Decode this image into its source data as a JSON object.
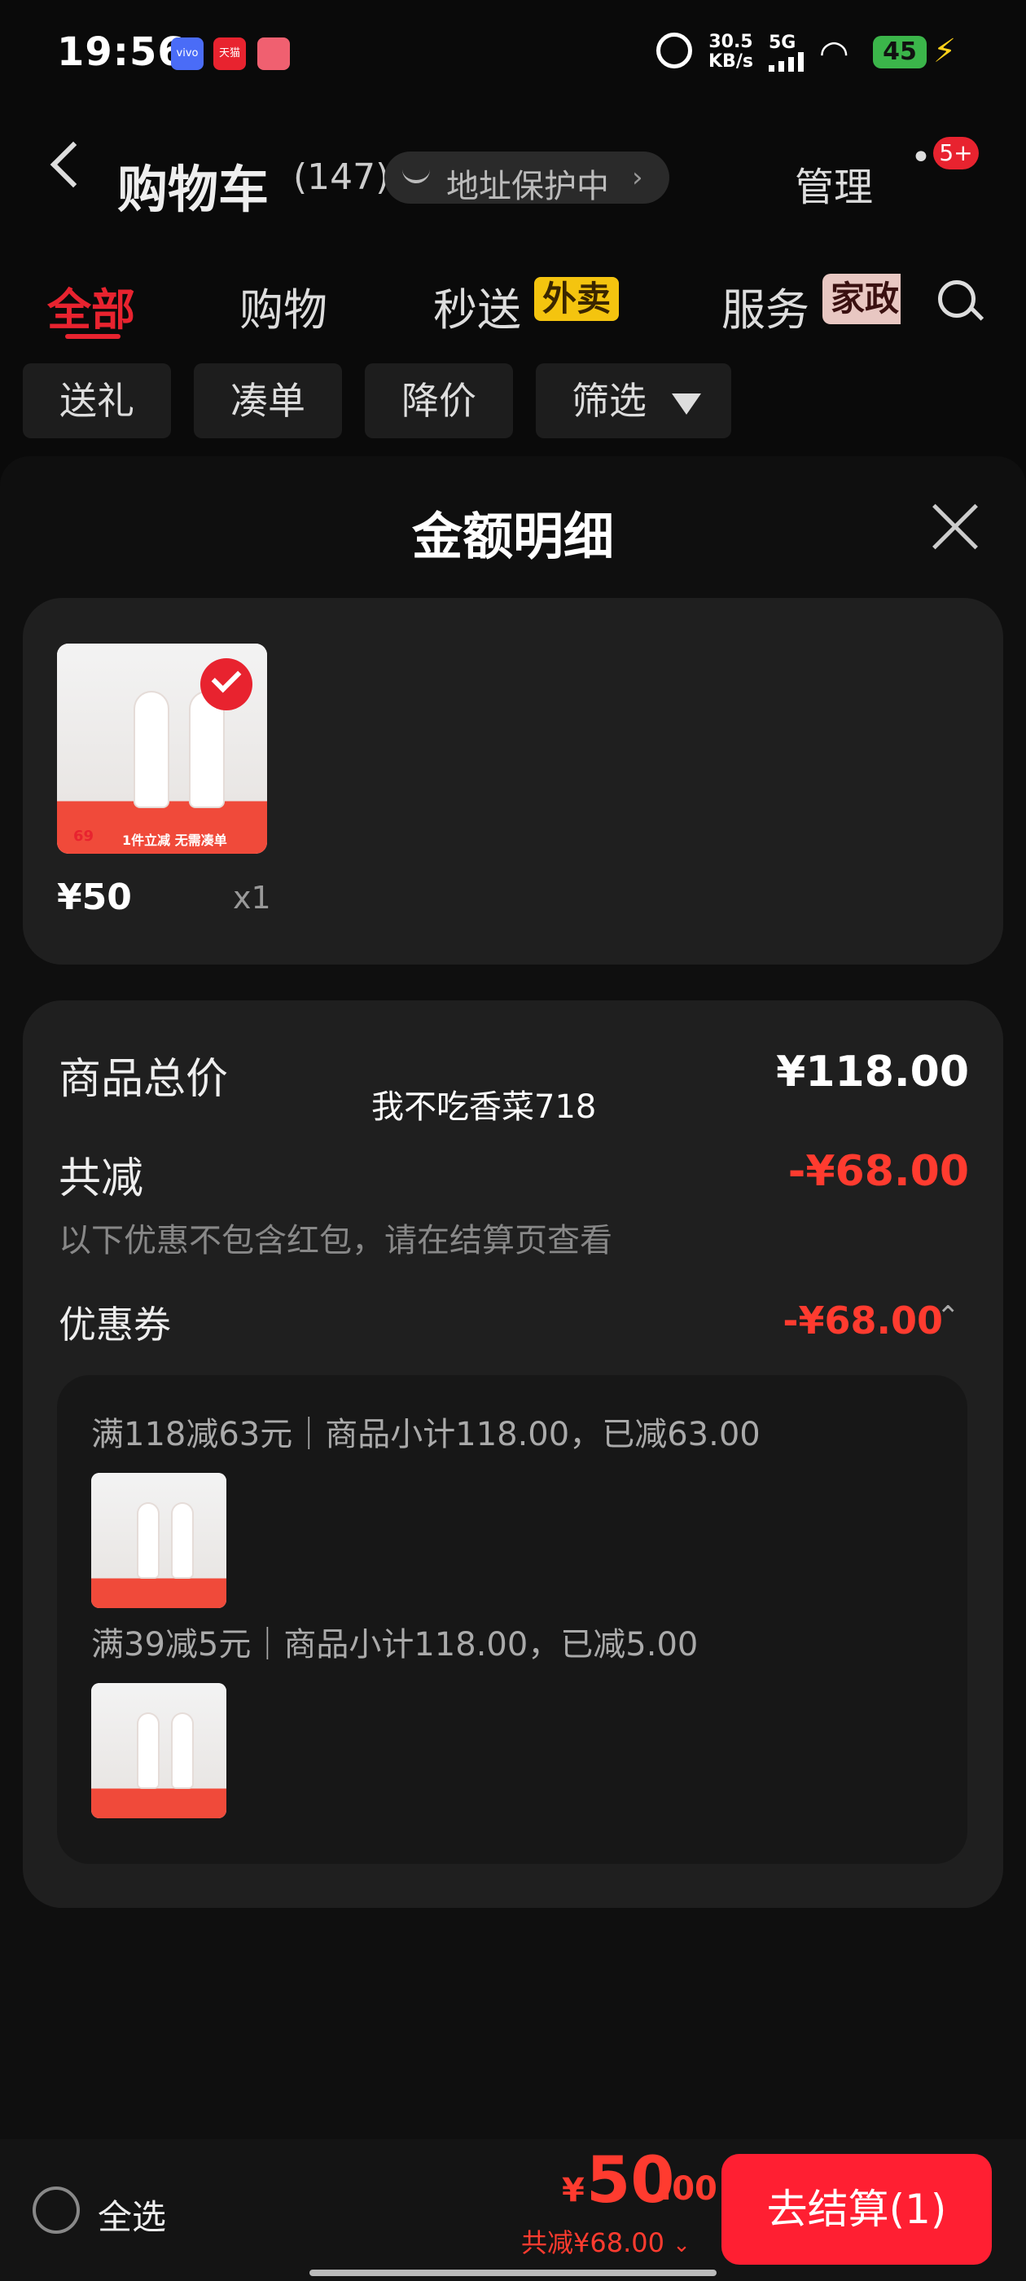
{
  "status_bar": {
    "time": "19:56",
    "net_speed_value": "30.5",
    "net_speed_unit": "KB/s",
    "network": "5G",
    "battery": "45",
    "apps": [
      "vivo",
      "天猫"
    ]
  },
  "nav": {
    "title": "购物车",
    "count": "(147)",
    "address_badge": "地址保护中",
    "manage": "管理",
    "message_badge": "5+"
  },
  "tabs": [
    {
      "label": "全部",
      "active": true
    },
    {
      "label": "购物"
    },
    {
      "label": "秒送",
      "tag": "外卖"
    },
    {
      "label": "服务",
      "tag": "家政"
    }
  ],
  "chips": [
    "送礼",
    "凑单",
    "降价",
    "筛选"
  ],
  "sheet": {
    "title": "金额明细",
    "product": {
      "price": "¥50",
      "qty": "x1",
      "promo_text": "1件立减 无需凑单",
      "tag": "69"
    },
    "summary": {
      "total_label": "商品总价",
      "total_value": "¥118.00",
      "discount_label": "共减",
      "discount_value": "-¥68.00",
      "note": "以下优惠不包含红包，请在结算页查看",
      "coupon_label": "优惠券",
      "coupon_value": "-¥68.00",
      "watermark": "我不吃香菜718"
    },
    "coupons": [
      {
        "text": "满118减63元｜商品小计118.00，已减63.00"
      },
      {
        "text": "满39减5元｜商品小计118.00，已减5.00"
      }
    ]
  },
  "bottom": {
    "select_all": "全选",
    "yen": "¥",
    "price_int": "50",
    "price_dec": ".00",
    "saved": "共减¥68.00",
    "checkout": "去结算(1)"
  },
  "colors": {
    "accent": "#e8232f",
    "price_red": "#ff3b2f",
    "yellow_tag": "#f4c40f"
  }
}
